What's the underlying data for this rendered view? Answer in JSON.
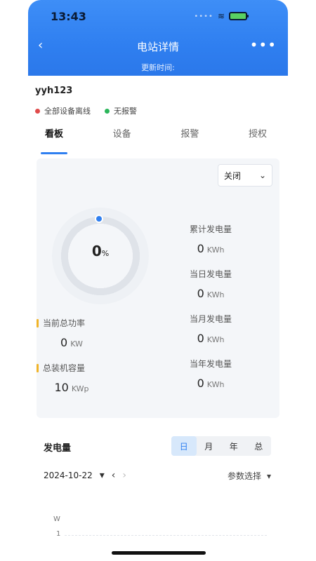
{
  "status_bar": {
    "time": "13:43"
  },
  "nav": {
    "title": "电站详情",
    "subtitle": "更新时间:"
  },
  "station": {
    "name": "yyh123"
  },
  "statuses": [
    {
      "text": "全部设备离线"
    },
    {
      "text": "无报警"
    }
  ],
  "tabs": [
    "看板",
    "设备",
    "报警",
    "授权"
  ],
  "select": {
    "value": "关闭"
  },
  "gauge": {
    "value": "0",
    "unit": "%"
  },
  "left_stats": [
    {
      "label": "当前总功率",
      "value": "0",
      "unit": "KW"
    },
    {
      "label": "总装机容量",
      "value": "10",
      "unit": "KWp"
    }
  ],
  "right_stats": [
    {
      "label": "累计发电量",
      "value": "0",
      "unit": "KWh"
    },
    {
      "label": "当日发电量",
      "value": "0",
      "unit": "KWh"
    },
    {
      "label": "当月发电量",
      "value": "0",
      "unit": "KWh"
    },
    {
      "label": "当年发电量",
      "value": "0",
      "unit": "KWh"
    }
  ],
  "chart_section": {
    "title": "发电量",
    "periods": [
      "日",
      "月",
      "年",
      "总"
    ],
    "active_period": "日",
    "date": "2024-10-22",
    "param_select": "参数选择",
    "axis_unit": "W",
    "axis_tick": "1"
  }
}
